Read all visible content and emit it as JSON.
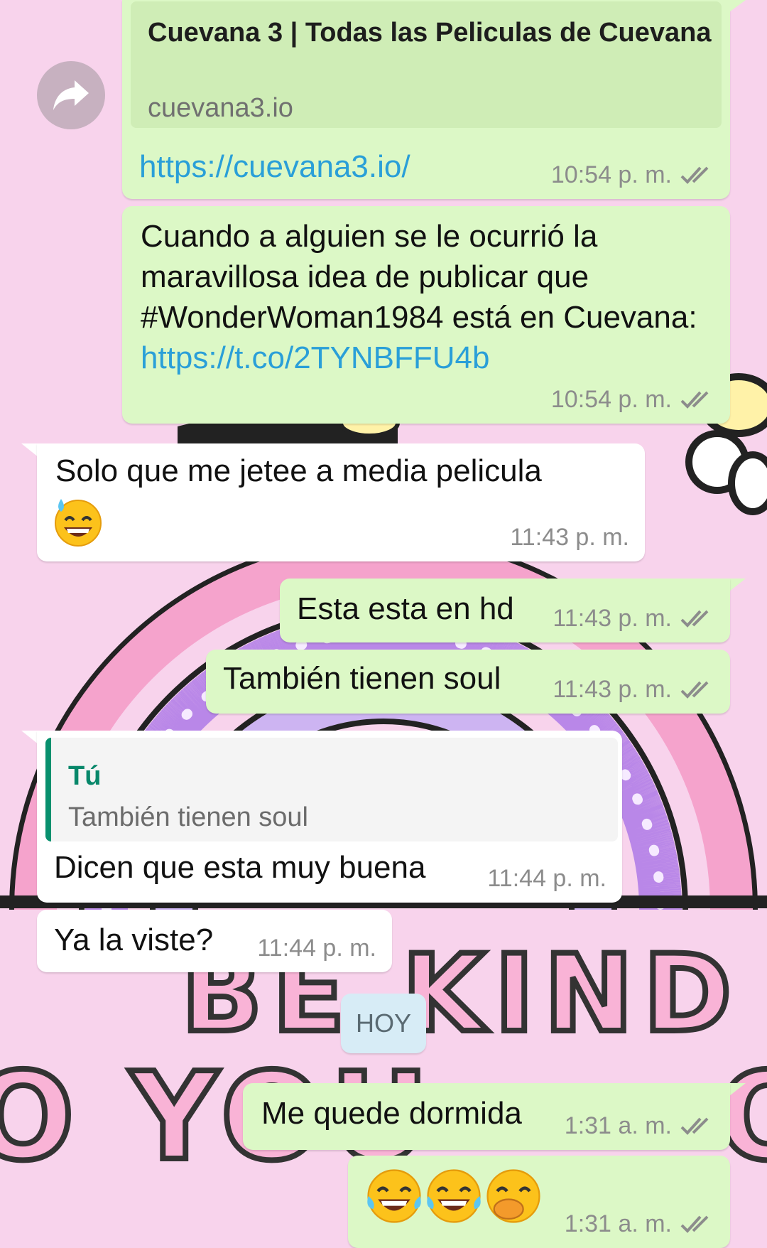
{
  "chat": {
    "messages": [
      {
        "direction": "outgoing",
        "link_preview": {
          "title": "Cuevana 3 | Todas las Peliculas de Cuevana",
          "domain": "cuevana3.io"
        },
        "text": "https://cuevana3.io/",
        "time": "10:54 p. m.",
        "status": "read"
      },
      {
        "direction": "outgoing",
        "text": "Cuando a alguien se le ocurrió la maravillosa idea de publicar que #WonderWoman1984 está en Cuevana: ",
        "link": "https://t.co/2TYNBFFU4b",
        "time": "10:54 p. m.",
        "status": "read"
      },
      {
        "direction": "incoming",
        "text": "Solo que me jetee a media pelicula",
        "emoji": "sweat-smile-emoji",
        "time": "11:43 p. m."
      },
      {
        "direction": "outgoing",
        "text": "Esta esta en hd",
        "time": "11:43 p. m.",
        "status": "read"
      },
      {
        "direction": "outgoing",
        "text": "También tienen soul",
        "time": "11:43 p. m.",
        "status": "read"
      },
      {
        "direction": "incoming",
        "quote": {
          "author": "Tú",
          "text": "También tienen soul"
        },
        "text": "Dicen que esta muy buena",
        "time": "11:44 p. m."
      },
      {
        "direction": "incoming",
        "text": "Ya la viste?",
        "time": "11:44 p. m."
      },
      {
        "direction": "outgoing",
        "text": "Me quede dormida",
        "time": "1:31 a. m.",
        "status": "read"
      },
      {
        "direction": "outgoing",
        "emojis": [
          "tears-of-joy-emoji",
          "tears-of-joy-emoji",
          "hand-over-mouth-emoji"
        ],
        "time": "1:31 a. m.",
        "status": "read"
      }
    ],
    "date_separator": "HOY"
  },
  "wallpaper": {
    "texts": [
      "BE KIND",
      "YOU"
    ],
    "colors": {
      "background": "#f8d3ec",
      "rainbow_pink": "#f5a3cc",
      "rainbow_purple": "#b987e8",
      "rainbow_lavender": "#cdb4f2"
    }
  },
  "colors": {
    "outgoing_bubble": "#dcf8c6",
    "incoming_bubble": "#ffffff",
    "link": "#2a9fd8",
    "read_ticks": "#8c8c8c",
    "quote_bar": "#08906e",
    "date_chip": "#d7ecf6"
  }
}
